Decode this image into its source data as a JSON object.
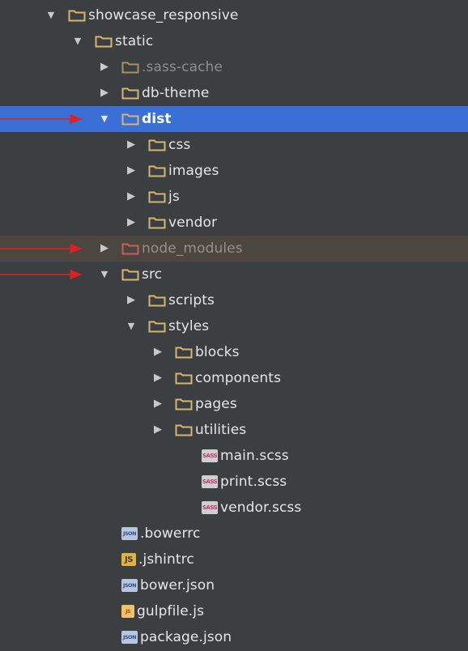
{
  "colors": {
    "background": "#3c3f41",
    "selected_row": "#3a6fd6",
    "excluded_row": "#4b4640",
    "folder": "#d6b570",
    "excluded_folder": "#c0605a",
    "annotation_arrow": "#e02020"
  },
  "tree": [
    {
      "label": "showcase_responsive",
      "depth": 0,
      "state": "expanded",
      "icon": "folder-icon"
    },
    {
      "label": "static",
      "depth": 1,
      "state": "expanded",
      "icon": "folder-icon"
    },
    {
      "label": ".sass-cache",
      "depth": 2,
      "state": "collapsed",
      "icon": "folder-icon",
      "style": "muted"
    },
    {
      "label": "db-theme",
      "depth": 2,
      "state": "collapsed",
      "icon": "folder-icon"
    },
    {
      "label": "dist",
      "depth": 2,
      "state": "expanded",
      "icon": "folder-icon",
      "selected": true
    },
    {
      "label": "css",
      "depth": 3,
      "state": "collapsed",
      "icon": "folder-icon"
    },
    {
      "label": "images",
      "depth": 3,
      "state": "collapsed",
      "icon": "folder-icon"
    },
    {
      "label": "js",
      "depth": 3,
      "state": "collapsed",
      "icon": "folder-icon"
    },
    {
      "label": "vendor",
      "depth": 3,
      "state": "collapsed",
      "icon": "folder-icon"
    },
    {
      "label": "node_modules",
      "depth": 2,
      "state": "collapsed",
      "icon": "excluded-folder-icon",
      "excluded": true
    },
    {
      "label": "src",
      "depth": 2,
      "state": "expanded",
      "icon": "folder-icon"
    },
    {
      "label": "scripts",
      "depth": 3,
      "state": "collapsed",
      "icon": "folder-icon"
    },
    {
      "label": "styles",
      "depth": 3,
      "state": "expanded",
      "icon": "folder-icon"
    },
    {
      "label": "blocks",
      "depth": 4,
      "state": "collapsed",
      "icon": "folder-icon"
    },
    {
      "label": "components",
      "depth": 4,
      "state": "collapsed",
      "icon": "folder-icon"
    },
    {
      "label": "pages",
      "depth": 4,
      "state": "collapsed",
      "icon": "folder-icon"
    },
    {
      "label": "utilities",
      "depth": 4,
      "state": "collapsed",
      "icon": "folder-icon"
    },
    {
      "label": "main.scss",
      "depth": 5,
      "state": "leaf",
      "icon": "sass-file-icon",
      "badge": "SASS"
    },
    {
      "label": "print.scss",
      "depth": 5,
      "state": "leaf",
      "icon": "sass-file-icon",
      "badge": "SASS"
    },
    {
      "label": "vendor.scss",
      "depth": 5,
      "state": "leaf",
      "icon": "sass-file-icon",
      "badge": "SASS"
    },
    {
      "label": ".bowerrc",
      "depth": 2,
      "state": "leaf",
      "icon": "json-file-icon",
      "badge": "JSON"
    },
    {
      "label": ".jshintrc",
      "depth": 2,
      "state": "leaf",
      "icon": "js-file-icon",
      "badge": "JS"
    },
    {
      "label": "bower.json",
      "depth": 2,
      "state": "leaf",
      "icon": "json-file-icon",
      "badge": "JSON"
    },
    {
      "label": "gulpfile.js",
      "depth": 2,
      "state": "leaf",
      "icon": "javascript-file-icon",
      "badge": "JS"
    },
    {
      "label": "package.json",
      "depth": 2,
      "state": "leaf",
      "icon": "json-file-icon",
      "badge": "JSON"
    }
  ],
  "annotations": [
    {
      "points_to": "dist"
    },
    {
      "points_to": "node_modules"
    },
    {
      "points_to": "src"
    }
  ]
}
